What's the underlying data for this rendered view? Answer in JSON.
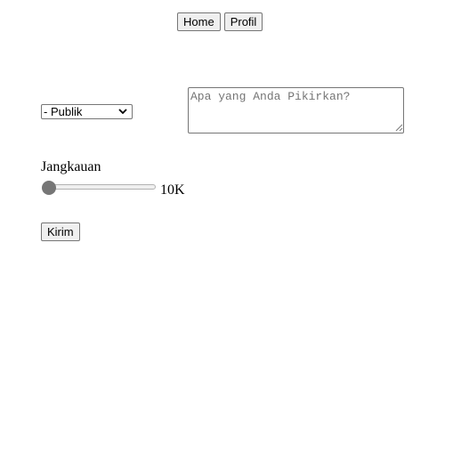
{
  "nav": {
    "home_label": "Home",
    "profile_label": "Profil"
  },
  "post_form": {
    "visibility": {
      "selected": "- Publik"
    },
    "text": {
      "value": "",
      "placeholder": "Apa yang Anda Pikirkan?"
    },
    "range": {
      "label": "Jangkauan",
      "value_text": "10K",
      "position": 0
    },
    "submit_label": "Kirim"
  }
}
